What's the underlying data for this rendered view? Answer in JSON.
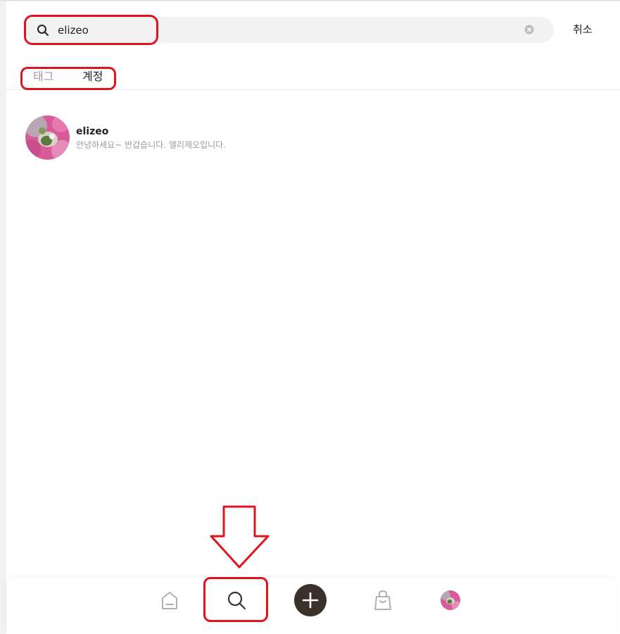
{
  "search": {
    "value": "elizeo",
    "cancel_label": "취소"
  },
  "tabs": [
    {
      "label": "태그",
      "active": false
    },
    {
      "label": "계정",
      "active": true
    }
  ],
  "results": [
    {
      "username": "elizeo",
      "bio": "안녕하세요~ 반갑습니다. 엘리제오입니다."
    }
  ],
  "bottom_nav": {
    "items": [
      {
        "icon": "home-icon",
        "active": false
      },
      {
        "icon": "search-icon",
        "active": true
      },
      {
        "icon": "plus-icon",
        "active": false
      },
      {
        "icon": "shopping-bag-icon",
        "active": false
      },
      {
        "icon": "profile-avatar",
        "active": false
      }
    ]
  },
  "colors": {
    "annotation": "#e0141e",
    "primary_button": "#3a302c",
    "inactive_tab": "#9a9a9a",
    "search_bg": "#f2f2f2"
  }
}
